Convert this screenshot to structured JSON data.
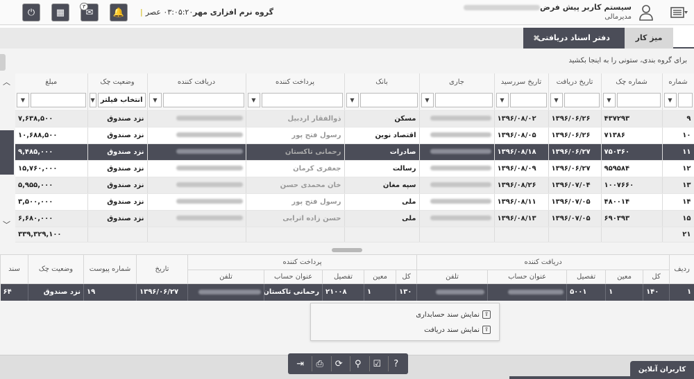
{
  "header": {
    "clock": "۰۳:۰۵:۲۰ عصر",
    "company": "گروه نرم افزاری مهر",
    "system_title": "سیستم کاربر پیش فرض",
    "role": "مدیرمالی",
    "msg_badge": "۳",
    "icons": [
      "power-icon",
      "calculator-icon",
      "mail-icon",
      "bell-icon",
      "user-icon",
      "menu-icon"
    ]
  },
  "tabs": {
    "desk": "میز کار",
    "docs": "دفتر اسناد دریافتی",
    "close": "✖"
  },
  "group_hint": "برای گروه بندی، ستونی را به اینجا بکشید",
  "grid": {
    "columns": [
      "شماره",
      "شماره چک",
      "تاریخ دریافت",
      "تاریخ سررسید",
      "جاری",
      "بانک",
      "پرداخت کننده",
      "دریافت کننده",
      "وضعیت چک",
      "مبلغ"
    ],
    "status_filter": "انتخاب فیلتر",
    "rows": [
      {
        "n": "۹",
        "check": "۴۳۷۲۹۳",
        "recv": "۱۳۹۶/۰۶/۲۶",
        "due": "۱۳۹۶/۰۸/۰۲",
        "bank": "مسکن",
        "payer": "ذوالفقار اردبیل",
        "status": "نزد صندوق",
        "amount": "۷,۶۳۸,۵۰۰"
      },
      {
        "n": "۱۰",
        "check": "۷۱۳۸۶",
        "recv": "۱۳۹۶/۰۶/۲۶",
        "due": "۱۳۹۶/۰۸/۰۵",
        "bank": "اقتصاد نوین",
        "payer": "رسول فتح پور",
        "status": "نزد صندوق",
        "amount": "۱۰,۶۸۸,۵۰۰"
      },
      {
        "n": "۱۱",
        "check": "۷۵۰۳۶۰",
        "recv": "۱۳۹۶/۰۶/۲۷",
        "due": "۱۳۹۶/۰۸/۱۸",
        "bank": "صادرات",
        "payer": "رحمانی تاکستان",
        "status": "نزد صندوق",
        "amount": "۹,۴۸۵,۰۰۰"
      },
      {
        "n": "۱۲",
        "check": "۹۵۹۵۸۴",
        "recv": "۱۳۹۶/۰۶/۲۷",
        "due": "۱۳۹۶/۰۸/۰۹",
        "bank": "رسالت",
        "payer": "جعفری کرمان",
        "status": "نزد صندوق",
        "amount": "۱۵,۷۶۰,۰۰۰"
      },
      {
        "n": "۱۳",
        "check": "۱۰۰۷۶۶۰",
        "recv": "۱۳۹۶/۰۷/۰۴",
        "due": "۱۳۹۶/۰۸/۲۶",
        "bank": "سپه مغان",
        "payer": "خان محمدی حسن",
        "status": "نزد صندوق",
        "amount": "۵,۹۵۵,۰۰۰"
      },
      {
        "n": "۱۴",
        "check": "۴۸۰۰۱۴",
        "recv": "۱۳۹۶/۰۷/۰۵",
        "due": "۱۳۹۶/۰۸/۱۱",
        "bank": "ملی",
        "payer": "رسول فتح پور",
        "status": "نزد صندوق",
        "amount": "۳,۵۰۰,۰۰۰"
      },
      {
        "n": "۱۵",
        "check": "۶۹۰۳۹۳",
        "recv": "۱۳۹۶/۰۷/۰۵",
        "due": "۱۳۹۶/۰۸/۱۳",
        "bank": "ملی",
        "payer": "حسن زاده اترابی",
        "status": "نزد صندوق",
        "amount": "۶,۶۸۰,۰۰۰"
      }
    ],
    "summary_count": "۲۱",
    "summary_total": "۳۳۹,۳۲۹,۱۰۰"
  },
  "detail": {
    "headers": {
      "row": "ردیف",
      "receiver": "دریافت کننده",
      "payer": "پرداخت کننده",
      "date": "تاریخ",
      "attach": "شماره پیوست",
      "status": "وضعیت چک",
      "doc": "سند"
    },
    "sub": {
      "kol": "کل",
      "moein": "معین",
      "tafsil": "تفصیل",
      "account_title": "عنوان حساب",
      "phone": "تلفن"
    },
    "row": {
      "n": "۱",
      "r_kol": "۱۴۰",
      "r_moein": "۱",
      "r_tafsil": "۵۰۰۱",
      "p_kol": "۱۳۰",
      "p_moein": "۱",
      "p_tafsil": "۲۱۰۰۸",
      "p_title": "رحمانی تاکستان",
      "date": "۱۳۹۶/۰۶/۲۷",
      "attach": "۱۹",
      "status": "نزد صندوق",
      "doc": "۶۴"
    }
  },
  "context_menu": {
    "item1": "نمایش سند حسابداری",
    "item2": "نمایش سند دریافت"
  },
  "footer": {
    "online_users": "کاربران آنلاین",
    "tools": [
      "help-icon",
      "checklist-icon",
      "zoom-icon",
      "refresh-icon",
      "print-icon",
      "export-icon"
    ]
  }
}
